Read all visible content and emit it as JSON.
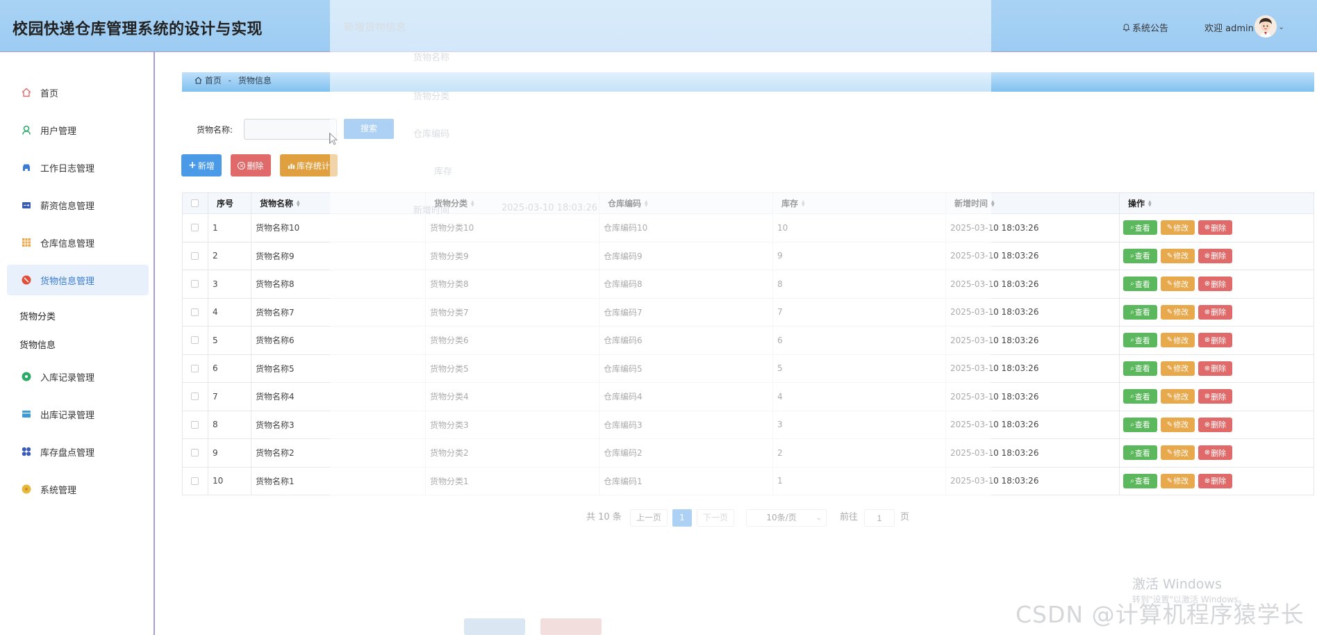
{
  "header": {
    "title": "校园快递仓库管理系统的设计与实现",
    "notice_label": "系统公告",
    "welcome_label": "欢迎 admin"
  },
  "sidebar": {
    "items": [
      {
        "label": "首页",
        "icon": "home-icon",
        "color": "#e06a6a"
      },
      {
        "label": "用户管理",
        "icon": "user-icon",
        "color": "#2eaa6a"
      },
      {
        "label": "工作日志管理",
        "icon": "car-icon",
        "color": "#3a7bd5"
      },
      {
        "label": "薪资信息管理",
        "icon": "wallet-icon",
        "color": "#3a5bb5"
      },
      {
        "label": "仓库信息管理",
        "icon": "grid-icon",
        "color": "#e8a84c"
      },
      {
        "label": "货物信息管理",
        "icon": "box-icon",
        "color": "#e0503a"
      },
      {
        "label": "入库记录管理",
        "icon": "circle-icon",
        "color": "#2eaa6a"
      },
      {
        "label": "出库记录管理",
        "icon": "inbox-icon",
        "color": "#3a9bd5"
      },
      {
        "label": "库存盘点管理",
        "icon": "apps-icon",
        "color": "#3a5bb5"
      },
      {
        "label": "系统管理",
        "icon": "settings-icon",
        "color": "#e8b83c"
      }
    ],
    "sub_items": [
      "货物分类",
      "货物信息"
    ]
  },
  "breadcrumb": {
    "home": "首页",
    "sep": "-",
    "current": "货物信息"
  },
  "search": {
    "label": "货物名称:",
    "placeholder": "",
    "button": "搜索"
  },
  "toolbar": {
    "add": "新增",
    "delete": "删除",
    "stats": "库存统计"
  },
  "table": {
    "columns": [
      "序号",
      "货物名称",
      "货物分类",
      "仓库编码",
      "库存",
      "新增时间",
      "操作"
    ],
    "rows": [
      {
        "no": "1",
        "name": "货物名称10",
        "category": "货物分类10",
        "code": "仓库编码10",
        "stock": "10",
        "time": "2025-03-10 18:03:26"
      },
      {
        "no": "2",
        "name": "货物名称9",
        "category": "货物分类9",
        "code": "仓库编码9",
        "stock": "9",
        "time": "2025-03-10 18:03:26"
      },
      {
        "no": "3",
        "name": "货物名称8",
        "category": "货物分类8",
        "code": "仓库编码8",
        "stock": "8",
        "time": "2025-03-10 18:03:26"
      },
      {
        "no": "4",
        "name": "货物名称7",
        "category": "货物分类7",
        "code": "仓库编码7",
        "stock": "7",
        "time": "2025-03-10 18:03:26"
      },
      {
        "no": "5",
        "name": "货物名称6",
        "category": "货物分类6",
        "code": "仓库编码6",
        "stock": "6",
        "time": "2025-03-10 18:03:26"
      },
      {
        "no": "6",
        "name": "货物名称5",
        "category": "货物分类5",
        "code": "仓库编码5",
        "stock": "5",
        "time": "2025-03-10 18:03:26"
      },
      {
        "no": "7",
        "name": "货物名称4",
        "category": "货物分类4",
        "code": "仓库编码4",
        "stock": "4",
        "time": "2025-03-10 18:03:26"
      },
      {
        "no": "8",
        "name": "货物名称3",
        "category": "货物分类3",
        "code": "仓库编码3",
        "stock": "3",
        "time": "2025-03-10 18:03:26"
      },
      {
        "no": "9",
        "name": "货物名称2",
        "category": "货物分类2",
        "code": "仓库编码2",
        "stock": "2",
        "time": "2025-03-10 18:03:26"
      },
      {
        "no": "10",
        "name": "货物名称1",
        "category": "货物分类1",
        "code": "仓库编码1",
        "stock": "1",
        "time": "2025-03-10 18:03:26"
      }
    ],
    "actions": {
      "view": "查看",
      "edit": "修改",
      "delete": "删除"
    }
  },
  "pagination": {
    "total": "共 10 条",
    "prev": "上一页",
    "current": "1",
    "next": "下一页",
    "page_size": "10条/页",
    "goto_label": "前往",
    "goto_value": "1",
    "page_suffix": "页"
  },
  "overlay": {
    "dialog_title": "新增货物信息",
    "field_labels": [
      "货物名称",
      "货物分类",
      "仓库编码",
      "库存"
    ],
    "time_label": "新增时间",
    "time_value": "2025-03-10 18:03:26"
  },
  "watermarks": {
    "windows_title": "激活 Windows",
    "windows_sub": "转到\"设置\"以激活 Windows。",
    "csdn": "CSDN @计算机程序猿学长"
  },
  "colors": {
    "header_bg": "#9ccbf2",
    "primary": "#4a9ae8",
    "danger": "#e06a6a",
    "warning": "#e8a84c",
    "success": "#5cb85c"
  }
}
